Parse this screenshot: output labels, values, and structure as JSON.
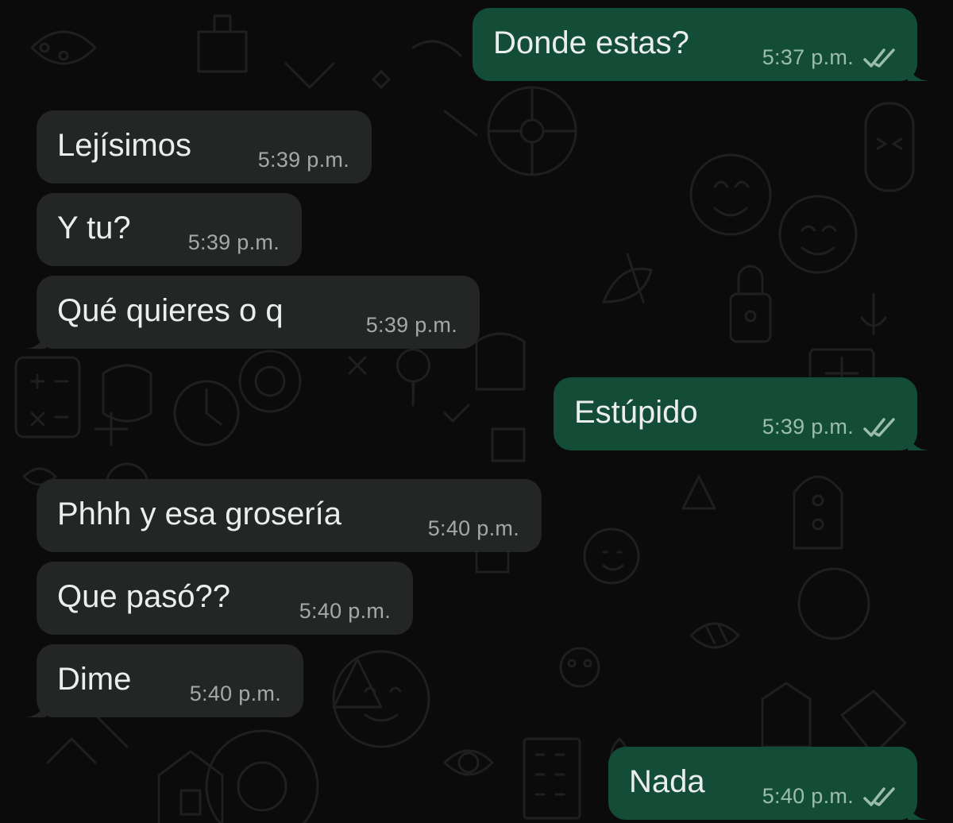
{
  "chat": {
    "messages": [
      {
        "direction": "out",
        "text": "Donde estas?",
        "time": "5:37 p.m.",
        "status": "read"
      },
      {
        "direction": "in",
        "text": "Lejísimos",
        "time": "5:39 p.m."
      },
      {
        "direction": "in",
        "text": "Y tu?",
        "time": "5:39 p.m."
      },
      {
        "direction": "in",
        "text": "Qué quieres o q",
        "time": "5:39 p.m."
      },
      {
        "direction": "out",
        "text": "Estúpido",
        "time": "5:39 p.m.",
        "status": "read"
      },
      {
        "direction": "in",
        "text": "Phhh y esa grosería",
        "time": "5:40 p.m."
      },
      {
        "direction": "in",
        "text": "Que pasó??",
        "time": "5:40 p.m."
      },
      {
        "direction": "in",
        "text": "Dime",
        "time": "5:40 p.m."
      },
      {
        "direction": "out",
        "text": "Nada",
        "time": "5:40 p.m.",
        "status": "read"
      }
    ]
  },
  "colors": {
    "background": "#0b0b0b",
    "incoming_bubble": "#242626",
    "outgoing_bubble": "#134d37",
    "text": "#ecedee",
    "timestamp": "#a4a8aa"
  },
  "icons": {
    "read_receipt": "double-check-icon",
    "wallpaper": "doodle-pattern"
  }
}
